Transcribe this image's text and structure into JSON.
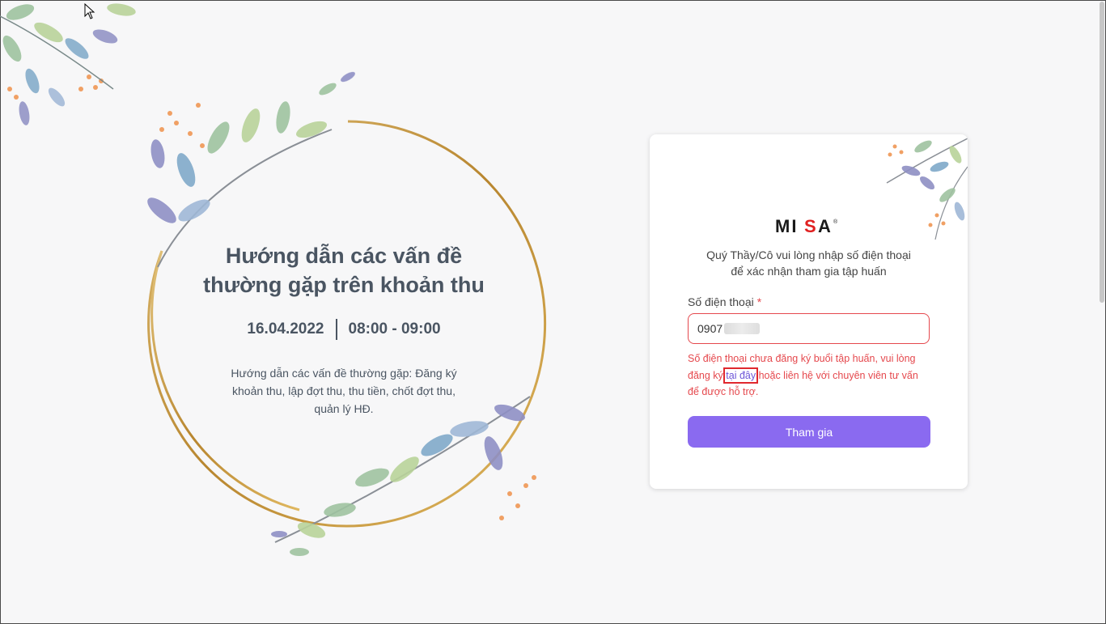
{
  "event": {
    "title_line1": "Hướng dẫn các vấn đề",
    "title_line2": "thường gặp trên khoản thu",
    "date": "16.04.2022",
    "time": "08:00 - 09:00",
    "description": "Hướng dẫn các vấn đề thường gặp: Đăng ký khoản thu, lập đợt thu, thu tiền, chốt đợt thu, quản lý HĐ."
  },
  "card": {
    "logo_text": "MISA",
    "intro_line1": "Quý Thầy/Cô vui lòng nhập số điện thoại",
    "intro_line2": "để xác nhận tham gia tập huấn",
    "phone_label": "Số điện thoại",
    "required_mark": "*",
    "phone_value": "0907",
    "error_before": "Số điện thoại chưa đăng ký buổi tập huấn, vui lòng đăng ký ",
    "error_link": "tại đây",
    "error_after": " hoặc liên hệ với chuyên viên tư vấn để được hỗ trợ.",
    "submit_label": "Tham gia"
  },
  "colors": {
    "accent": "#8a6af0",
    "error": "#e5484d",
    "text": "#4a5562",
    "gold": "#c99a4a"
  }
}
